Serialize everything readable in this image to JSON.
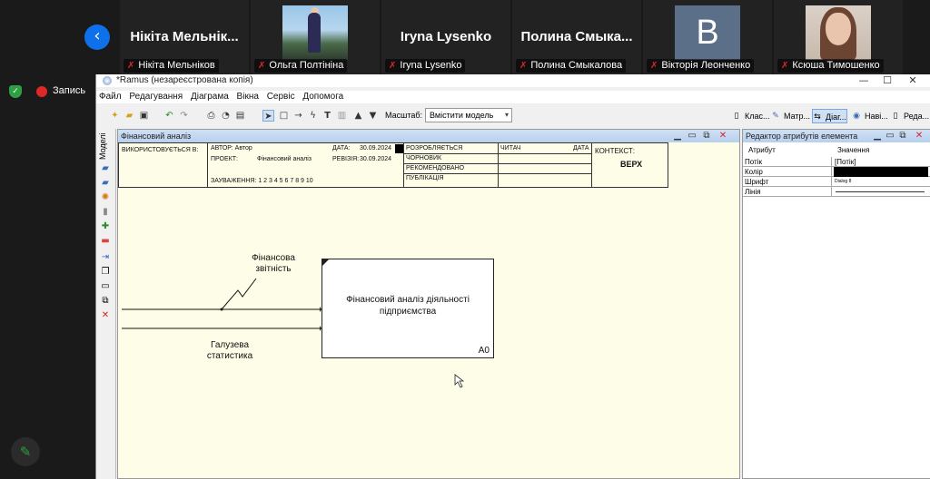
{
  "zoom": {
    "participants": [
      {
        "big_name": "Нікіта  Мельнік...",
        "label": "Нікіта Мельніков",
        "video": null
      },
      {
        "big_name": "",
        "label": "Ольга Полтініна",
        "video": "photo"
      },
      {
        "big_name": "Iryna Lysenko",
        "label": "Iryna Lysenko",
        "video": null
      },
      {
        "big_name": "Полина  Смыка...",
        "label": "Полина Смыкалова",
        "video": null
      },
      {
        "big_name": "",
        "label": "Вікторія Леонченко",
        "video": "avatar",
        "avatar_letter": "В"
      },
      {
        "big_name": "",
        "label": "Ксюша Тимошенко",
        "video": "photo"
      }
    ],
    "record_label": "Запись",
    "colors": {
      "mic_muted": "#e02828",
      "accent": "#0e71eb",
      "shield": "#2ea043"
    }
  },
  "app": {
    "title": "*Ramus (незареєстрована копія)",
    "menu": [
      "Файл",
      "Редагування",
      "Діаграма",
      "Вікна",
      "Сервіс",
      "Допомога"
    ],
    "zoom_label": "Масштаб:",
    "zoom_value": "Вмістити модель",
    "right_tabs": [
      "Клас...",
      "Матр...",
      "Діаг...",
      "Наві...",
      "Реда..."
    ],
    "side_panel_label": "Моделі"
  },
  "diagram": {
    "panel_title": "Фінансовий аналіз",
    "header": {
      "used_in": "ВИКОРИСТОВУЄТЬСЯ В:",
      "author": "АВТОР:  Автор",
      "project_label": "ПРОЕКТ:",
      "project": "Фінансовий аналіз",
      "date_label": "ДАТА:",
      "date": "30.09.2024",
      "rev_label": "РЕВІЗІЯ:",
      "rev": "30.09.2024",
      "notes": "ЗАУВАЖЕННЯ:  1  2  3  4  5  6  7  8  9  10",
      "status": [
        "РОЗРОБЛЯЄТЬСЯ",
        "ЧОРНОВИК",
        "РЕКОМЕНДОВАНО",
        "ПУБЛІКАЦІЯ"
      ],
      "reader": "ЧИТАЧ",
      "date_col": "ДАТА",
      "context": "КОНТЕКСТ:",
      "context_value": "ВЕРХ"
    },
    "activity": {
      "title": "Фінансовий аналіз діяльності підприємства",
      "node": "A0"
    },
    "arrows": [
      {
        "label": "Фінансова звітність"
      },
      {
        "label": "Галузева статистика"
      }
    ]
  },
  "attributes": {
    "panel_title": "Редактор атрибутів елемента",
    "col_attr": "Атрибут",
    "col_value": "Значення",
    "rows": [
      {
        "name": "Потік",
        "value": "[Потік]"
      },
      {
        "name": "Колір",
        "value": "",
        "color": "#000000"
      },
      {
        "name": "Шрифт",
        "value": "Dialog 8"
      },
      {
        "name": "Лінія",
        "value": ""
      }
    ]
  }
}
